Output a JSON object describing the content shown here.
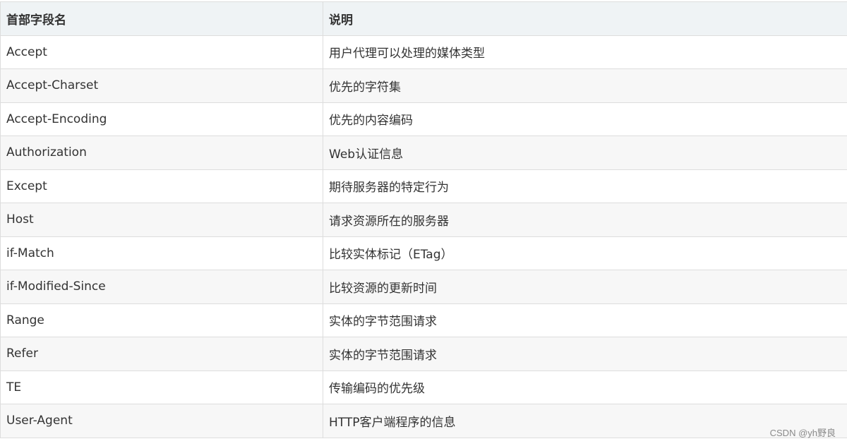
{
  "table": {
    "headers": [
      "首部字段名",
      "说明"
    ],
    "rows": [
      [
        "Accept",
        "用户代理可以处理的媒体类型"
      ],
      [
        "Accept-Charset",
        "优先的字符集"
      ],
      [
        "Accept-Encoding",
        "优先的内容编码"
      ],
      [
        "Authorization",
        "Web认证信息"
      ],
      [
        "Except",
        "期待服务器的特定行为"
      ],
      [
        "Host",
        "请求资源所在的服务器"
      ],
      [
        "if-Match",
        "比较实体标记（ETag）"
      ],
      [
        "if-Modified-Since",
        "比较资源的更新时间"
      ],
      [
        "Range",
        "实体的字节范围请求"
      ],
      [
        "Refer",
        "实体的字节范围请求"
      ],
      [
        "TE",
        "传输编码的优先级"
      ],
      [
        "User-Agent",
        "HTTP客户端程序的信息"
      ]
    ]
  },
  "watermark": "CSDN @yh野良"
}
